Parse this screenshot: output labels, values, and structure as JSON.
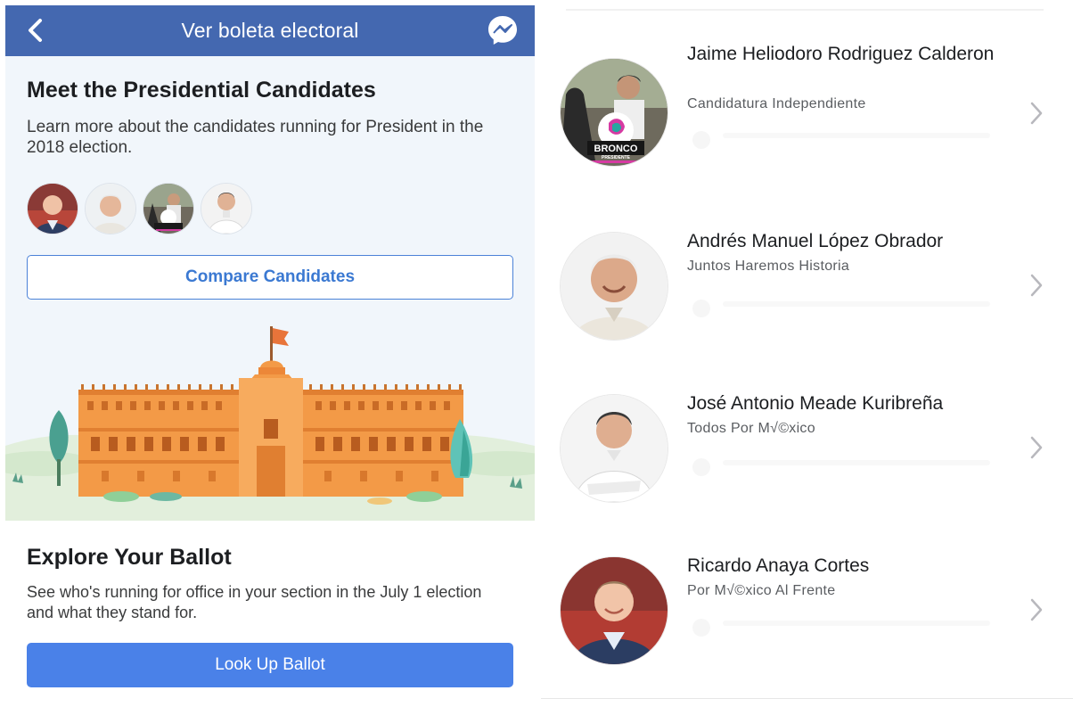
{
  "left": {
    "topbar": {
      "back_icon": "chevron-left-icon",
      "title": "Ver boleta electoral",
      "messenger_icon": "messenger-icon"
    },
    "meet": {
      "title": "Meet the Presidential Candidates",
      "description": "Learn more about the candidates running for President in the 2018 election.",
      "compare_label": "Compare Candidates"
    },
    "explore": {
      "title": "Explore Your Ballot",
      "description": "See who's running for office in your section in the July 1 election and what they stand for.",
      "button_label": "Look Up Ballot"
    }
  },
  "right": {
    "candidates": [
      {
        "name": "Jaime Heliodoro Rodriguez Calderon",
        "party": "Candidatura Independiente",
        "badge_text": "BRONCO",
        "badge_sub": "PRESIDENTE"
      },
      {
        "name": "Andrés Manuel López Obrador",
        "party": "Juntos Haremos Historia"
      },
      {
        "name": "José Antonio Meade Kuribreña",
        "party": "Todos Por M√©xico"
      },
      {
        "name": "Ricardo Anaya Cortes",
        "party": "Por M√©xico Al Frente"
      }
    ]
  },
  "colors": {
    "header_blue": "#4468b0",
    "button_blue": "#4a81e8",
    "link_blue": "#3b79d2",
    "building_orange": "#f39a47"
  }
}
